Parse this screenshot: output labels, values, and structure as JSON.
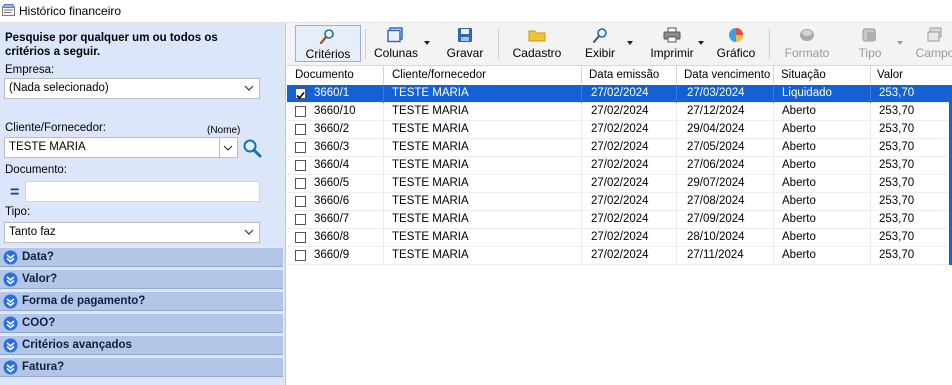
{
  "window": {
    "title": "Histórico financeiro"
  },
  "filters": {
    "heading": "Pesquise por qualquer um ou todos os critérios a seguir.",
    "empresa_label": "Empresa:",
    "empresa_value": "(Nada selecionado)",
    "cliente_label": "Cliente/Fornecedor:",
    "cliente_hint": "(Nome)",
    "cliente_value": "TESTE MARIA",
    "documento_label": "Documento:",
    "documento_operator": "=",
    "documento_value": "",
    "tipo_label": "Tipo:",
    "tipo_value": "Tanto faz"
  },
  "sections": [
    "Data?",
    "Valor?",
    "Forma de pagamento?",
    "COO?",
    "Critérios avançados",
    "Fatura?"
  ],
  "toolbar": {
    "criterios": "Critérios",
    "colunas": "Colunas",
    "gravar": "Gravar",
    "cadastro": "Cadastro",
    "exibir": "Exibir",
    "imprimir": "Imprimir",
    "grafico": "Gráfico",
    "formato": "Formato",
    "tipo": "Tipo",
    "campo": "Campo"
  },
  "columns": [
    "Documento",
    "Cliente/fornecedor",
    "Data emissão",
    "Data vencimento",
    "Situação",
    "Valor"
  ],
  "rows": [
    {
      "doc": "3660/1",
      "cliente": "TESTE MARIA",
      "emissao": "27/02/2024",
      "vencimento": "27/03/2024",
      "situacao": "Liquidado",
      "valor": "253,70",
      "checked": true,
      "selected": true
    },
    {
      "doc": "3660/10",
      "cliente": "TESTE MARIA",
      "emissao": "27/02/2024",
      "vencimento": "27/12/2024",
      "situacao": "Aberto",
      "valor": "253,70",
      "checked": false,
      "selected": false
    },
    {
      "doc": "3660/2",
      "cliente": "TESTE MARIA",
      "emissao": "27/02/2024",
      "vencimento": "29/04/2024",
      "situacao": "Aberto",
      "valor": "253,70",
      "checked": false,
      "selected": false
    },
    {
      "doc": "3660/3",
      "cliente": "TESTE MARIA",
      "emissao": "27/02/2024",
      "vencimento": "27/05/2024",
      "situacao": "Aberto",
      "valor": "253,70",
      "checked": false,
      "selected": false
    },
    {
      "doc": "3660/4",
      "cliente": "TESTE MARIA",
      "emissao": "27/02/2024",
      "vencimento": "27/06/2024",
      "situacao": "Aberto",
      "valor": "253,70",
      "checked": false,
      "selected": false
    },
    {
      "doc": "3660/5",
      "cliente": "TESTE MARIA",
      "emissao": "27/02/2024",
      "vencimento": "29/07/2024",
      "situacao": "Aberto",
      "valor": "253,70",
      "checked": false,
      "selected": false
    },
    {
      "doc": "3660/6",
      "cliente": "TESTE MARIA",
      "emissao": "27/02/2024",
      "vencimento": "27/08/2024",
      "situacao": "Aberto",
      "valor": "253,70",
      "checked": false,
      "selected": false
    },
    {
      "doc": "3660/7",
      "cliente": "TESTE MARIA",
      "emissao": "27/02/2024",
      "vencimento": "27/09/2024",
      "situacao": "Aberto",
      "valor": "253,70",
      "checked": false,
      "selected": false
    },
    {
      "doc": "3660/8",
      "cliente": "TESTE MARIA",
      "emissao": "27/02/2024",
      "vencimento": "28/10/2024",
      "situacao": "Aberto",
      "valor": "253,70",
      "checked": false,
      "selected": false
    },
    {
      "doc": "3660/9",
      "cliente": "TESTE MARIA",
      "emissao": "27/02/2024",
      "vencimento": "27/11/2024",
      "situacao": "Aberto",
      "valor": "253,70",
      "checked": false,
      "selected": false
    }
  ],
  "colors": {
    "panel": "#dbe6fa",
    "section": "#b4c6e8",
    "selection": "#1560d4",
    "accent": "#2a6fdb"
  }
}
